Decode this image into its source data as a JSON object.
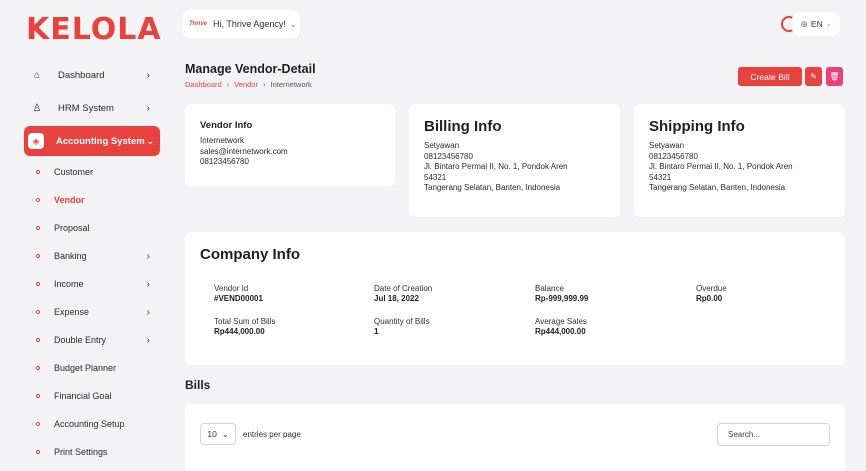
{
  "brand": {
    "logo_text": "KELOLA"
  },
  "header": {
    "greeting": "Hi, Thrive Agency!",
    "avatar_text": "Thrive",
    "language": "EN"
  },
  "sidebar": {
    "items": [
      {
        "label": "Dashboard",
        "icon": "home-icon"
      },
      {
        "label": "HRM System",
        "icon": "person-icon"
      },
      {
        "label": "Accounting System",
        "icon": "box-icon",
        "active": true
      }
    ],
    "sub_items": [
      {
        "label": "Customer"
      },
      {
        "label": "Vendor",
        "active": true
      },
      {
        "label": "Proposal"
      },
      {
        "label": "Banking",
        "has_children": true
      },
      {
        "label": "Income",
        "has_children": true
      },
      {
        "label": "Expense",
        "has_children": true
      },
      {
        "label": "Double Entry",
        "has_children": true
      },
      {
        "label": "Budget Planner"
      },
      {
        "label": "Financial Goal"
      },
      {
        "label": "Accounting Setup"
      },
      {
        "label": "Print Settings"
      }
    ]
  },
  "page": {
    "title": "Manage Vendor-Detail",
    "breadcrumb": [
      "Dashboard",
      "Vendor",
      "Internetwork"
    ],
    "create_bill_label": "Create Bill"
  },
  "vendor_info": {
    "title": "Vendor Info",
    "name": "Internetwork",
    "email": "sales@internetwork.com",
    "phone": "08123456780"
  },
  "billing_info": {
    "title": "Billing Info",
    "name": "Setyawan",
    "phone": "08123456780",
    "address": "Jl. Bintaro Permai II, No. 1, Pondok Aren",
    "postal": "54321",
    "region": "Tangerang Selatan, Banten, Indonesia"
  },
  "shipping_info": {
    "title": "Shipping Info",
    "name": "Setyawan",
    "phone": "08123456780",
    "address": "Jl. Bintaro Permai II, No. 1, Pondok Aren",
    "postal": "54321",
    "region": "Tangerang Selatan, Banten, Indonesia"
  },
  "company_info": {
    "title": "Company Info",
    "stats": [
      {
        "label": "Vendor Id",
        "value": "#VEND00001"
      },
      {
        "label": "Date of Creation",
        "value": "Jul 18, 2022"
      },
      {
        "label": "Balance",
        "value": "Rp-999,999.99"
      },
      {
        "label": "Overdue",
        "value": "Rp0.00"
      },
      {
        "label": "Total Sum of Bills",
        "value": "Rp444,000.00"
      },
      {
        "label": "Quantity of Bills",
        "value": "1"
      },
      {
        "label": "Average Sales",
        "value": "Rp444,000.00"
      }
    ]
  },
  "bills": {
    "title": "Bills",
    "entries_value": "10",
    "entries_label": "entries per page",
    "search_placeholder": "Search..."
  },
  "colors": {
    "accent": "#e8423e",
    "delete": "#e8427c",
    "background": "#f3f3f5"
  }
}
